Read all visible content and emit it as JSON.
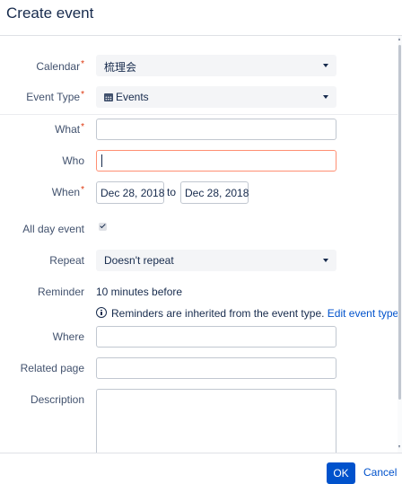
{
  "dialog": {
    "title": "Create event"
  },
  "form": {
    "calendar": {
      "label": "Calendar",
      "value": "梳理会"
    },
    "event_type": {
      "label": "Event Type",
      "value": "Events",
      "icon": "calendar-icon"
    },
    "what": {
      "label": "What",
      "value": ""
    },
    "who": {
      "label": "Who",
      "value": ""
    },
    "when": {
      "label": "When",
      "start": "Dec 28, 2018",
      "separator": "to",
      "end": "Dec 28, 2018"
    },
    "all_day": {
      "label": "All day event",
      "checked": true
    },
    "repeat": {
      "label": "Repeat",
      "value": "Doesn't repeat"
    },
    "reminder": {
      "label": "Reminder",
      "value": "10 minutes before",
      "info_text": "Reminders are inherited from the event type.",
      "info_link": "Edit event type",
      "info_icon": "info-icon"
    },
    "where": {
      "label": "Where",
      "value": ""
    },
    "related_page": {
      "label": "Related page",
      "value": ""
    },
    "description": {
      "label": "Description",
      "value": ""
    }
  },
  "footer": {
    "ok_label": "OK",
    "cancel_label": "Cancel"
  },
  "colors": {
    "primary": "#0052cc",
    "required": "#de350b",
    "focus_border": "#ff8f73"
  }
}
